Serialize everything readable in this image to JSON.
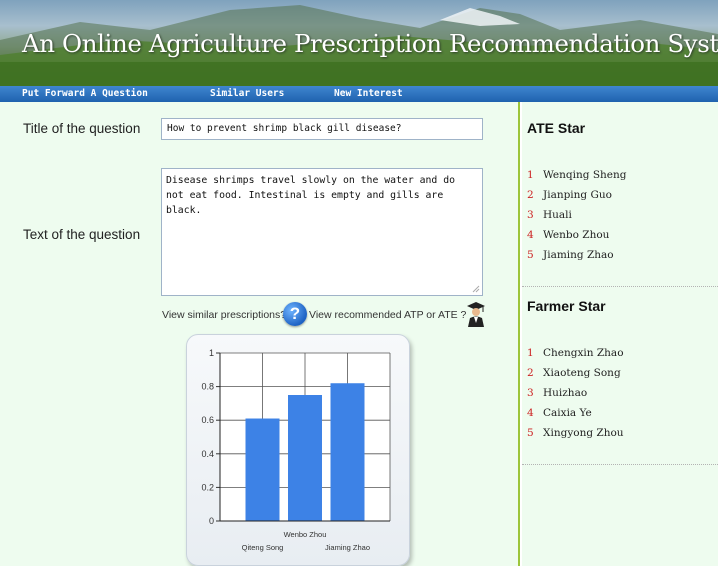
{
  "app": {
    "title": "An Online Agriculture Prescription Recommendation System"
  },
  "nav": {
    "items": [
      "Put Forward A Question",
      "Similar Users",
      "New Interest"
    ]
  },
  "form": {
    "title_label": "Title of the question",
    "title_value": "How to prevent shrimp black gill disease?",
    "text_label": "Text of the question",
    "text_value": "Disease shrimps travel slowly on the water and do not eat food. Intestinal is empty and gills are black."
  },
  "links": {
    "similar": "View similar prescriptions?",
    "recommended": "View recommended ATP or ATE ?"
  },
  "icons": {
    "help": "question-mark-icon",
    "graduate": "graduate-icon"
  },
  "chart_data": {
    "type": "bar",
    "categories": [
      "Qiteng Song",
      "Wenbo Zhou",
      "Jiaming Zhao"
    ],
    "values": [
      0.61,
      0.75,
      0.82
    ],
    "ylim": [
      0,
      1
    ],
    "yticks": [
      "0",
      "0.2",
      "0.4",
      "0.6",
      "0.8",
      "1"
    ],
    "grid": true,
    "bar_color": "#3d82e6"
  },
  "sidebar": {
    "ate_heading": "ATE Star",
    "ate_list": [
      {
        "num": "1",
        "name": "Wenqing Sheng"
      },
      {
        "num": "2",
        "name": "Jianping Guo"
      },
      {
        "num": "3",
        "name": "Huali"
      },
      {
        "num": "4",
        "name": "Wenbo Zhou"
      },
      {
        "num": "5",
        "name": "Jiaming Zhao"
      }
    ],
    "farmer_heading": "Farmer Star",
    "farmer_list": [
      {
        "num": "1",
        "name": "Chengxin Zhao"
      },
      {
        "num": "2",
        "name": "Xiaoteng Song"
      },
      {
        "num": "3",
        "name": "Huizhao"
      },
      {
        "num": "4",
        "name": "Caixia Ye"
      },
      {
        "num": "5",
        "name": "Xingyong Zhou"
      }
    ]
  },
  "colors": {
    "nav": "#1f62ae",
    "panel_bg": "#eefcef",
    "divider": "#9cc53a",
    "rank_number": "#cc2222"
  }
}
